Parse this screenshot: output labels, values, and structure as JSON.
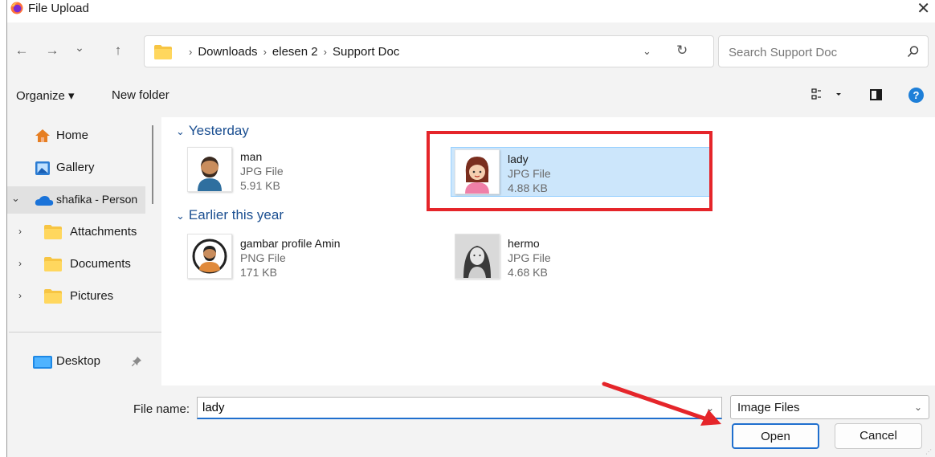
{
  "window": {
    "title": "File Upload",
    "close_glyph": "✕",
    "app_icon": "firefox-icon"
  },
  "address": {
    "back": "←",
    "forward": "→",
    "recent": "⌄",
    "up": "↑",
    "breadcrumbs": [
      "Downloads",
      "elesen 2",
      "Support Doc"
    ],
    "separator": "›",
    "dropdown": "⌄",
    "refresh": "↻",
    "search_placeholder": "Search Support Doc"
  },
  "toolbar": {
    "organize": "Organize ▾",
    "new_folder": "New folder",
    "help": "?"
  },
  "sidebar": {
    "items": [
      {
        "label": "Home",
        "icon": "home-icon"
      },
      {
        "label": "Gallery",
        "icon": "gallery-icon"
      },
      {
        "label": "shafika - Person",
        "icon": "onedrive-icon",
        "expanded_glyph": "⌄"
      },
      {
        "label": "Attachments",
        "icon": "folder-icon",
        "chevron": "›"
      },
      {
        "label": "Documents",
        "icon": "folder-icon",
        "chevron": "›"
      },
      {
        "label": "Pictures",
        "icon": "folder-icon",
        "chevron": "›"
      },
      {
        "label": "Desktop",
        "icon": "desktop-icon",
        "pin": "pin-icon"
      }
    ]
  },
  "groups": [
    {
      "title": "Yesterday",
      "files": [
        {
          "name": "man",
          "type": "JPG File",
          "size": "5.91 KB",
          "thumb": "man-avatar-icon"
        },
        {
          "name": "lady",
          "type": "JPG File",
          "size": "4.88 KB",
          "thumb": "lady-avatar-icon",
          "selected": true
        }
      ]
    },
    {
      "title": "Earlier this year",
      "files": [
        {
          "name": "gambar profile Amin",
          "type": "PNG File",
          "size": "171 KB",
          "thumb": "profile-avatar-icon"
        },
        {
          "name": "hermo",
          "type": "JPG File",
          "size": "4.68 KB",
          "thumb": "photo-portrait-icon"
        }
      ]
    }
  ],
  "group_chevron": "⌄",
  "footer": {
    "file_name_label": "File name:",
    "file_name_value": "lady",
    "file_type": "Image Files",
    "dropdown": "⌄",
    "open": "Open",
    "cancel": "Cancel"
  },
  "colors": {
    "accent": "#1f6fce",
    "selection": "#cce6fb",
    "highlight": "#e5252a",
    "group_header": "#1b4f91"
  }
}
